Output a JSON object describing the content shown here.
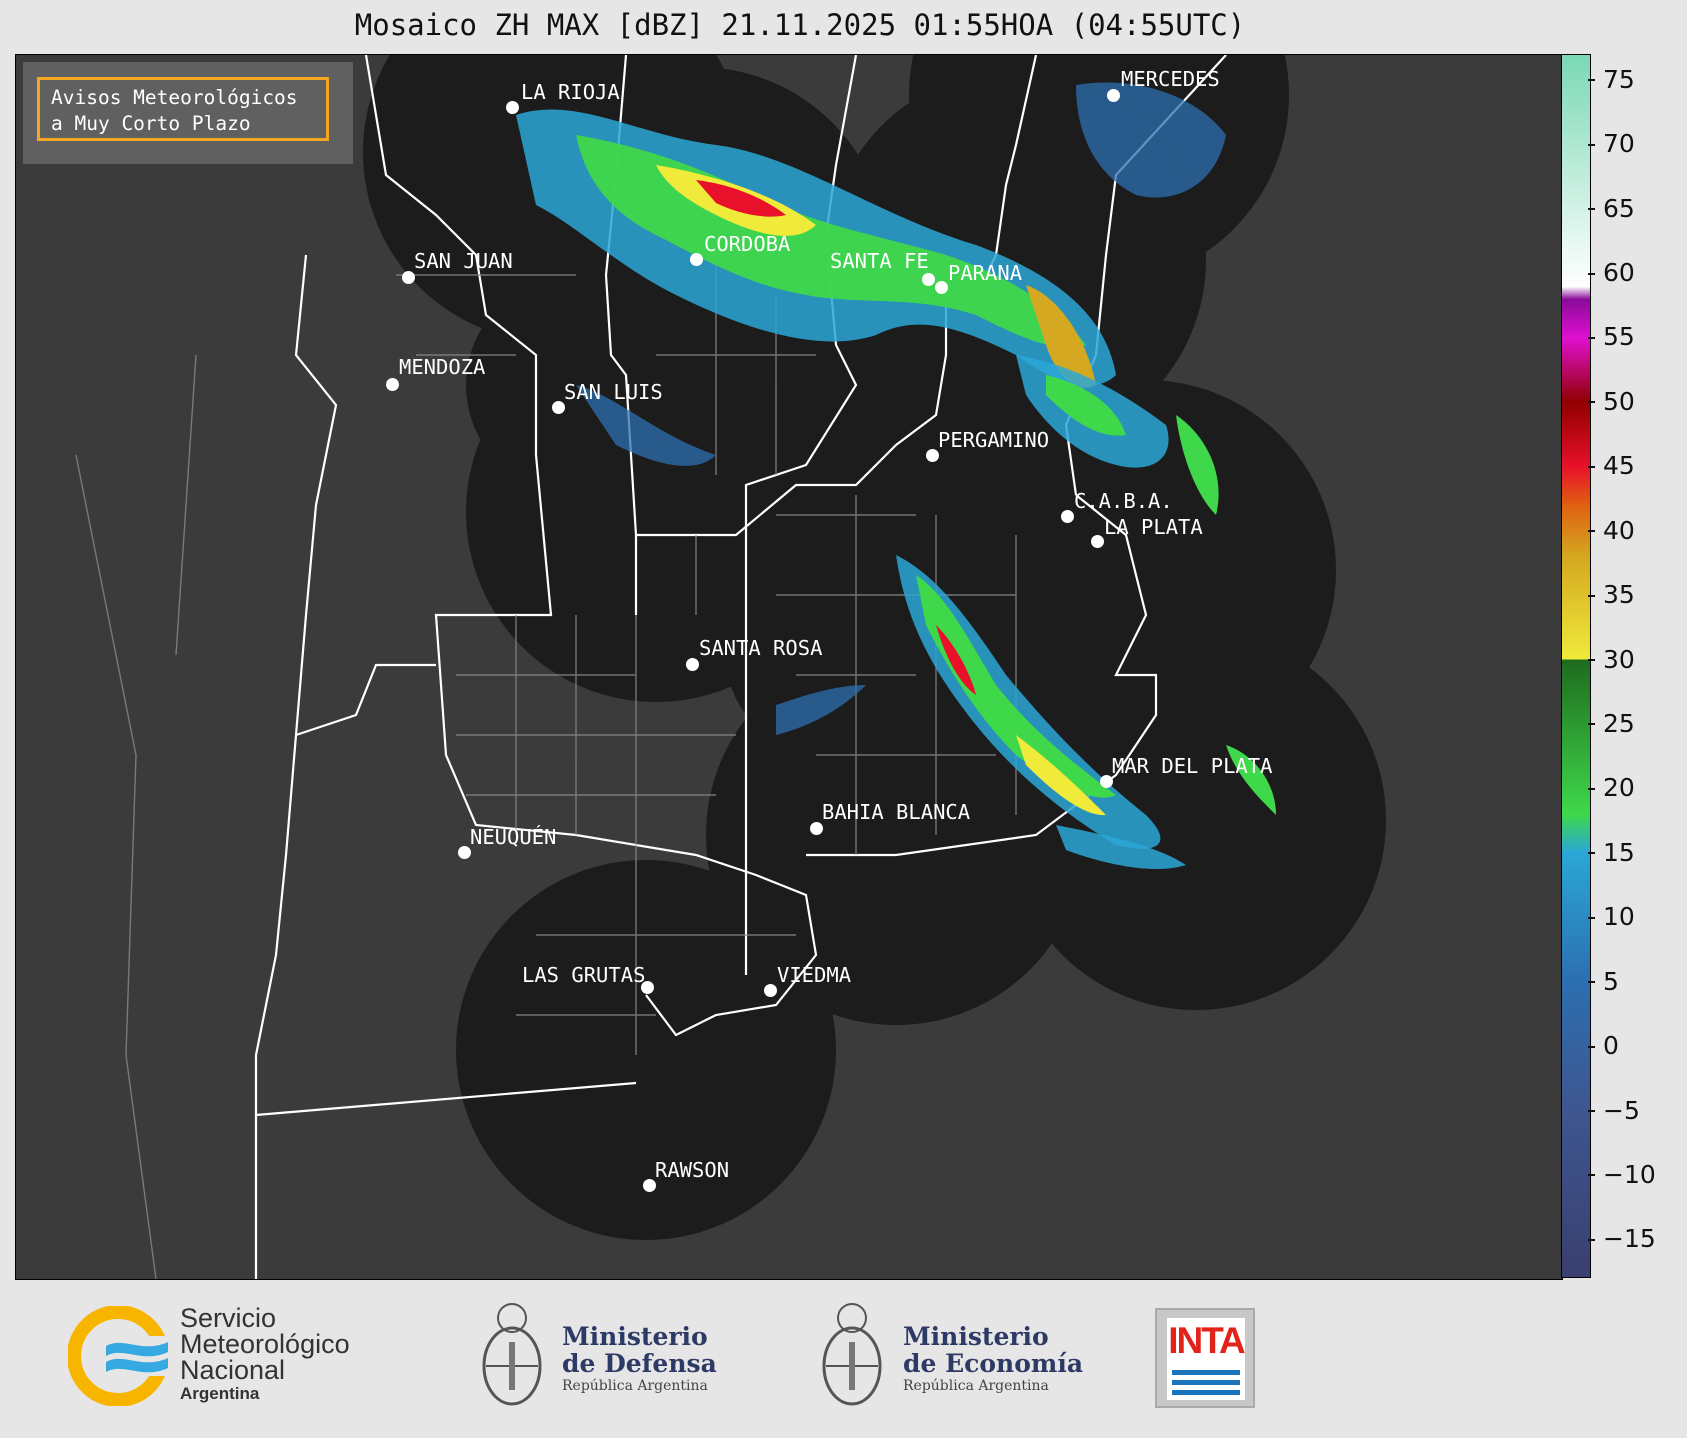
{
  "title": "Mosaico ZH MAX [dBZ] 21.11.2025 01:55HOA (04:55UTC)",
  "notice": {
    "line1": "Avisos Meteorológicos",
    "line2": "a Muy Corto Plazo"
  },
  "cities": [
    {
      "name": "LA RIOJA"
    },
    {
      "name": "MERCEDES"
    },
    {
      "name": "CORDOBA"
    },
    {
      "name": "SAN JUAN"
    },
    {
      "name": "SANTA FE"
    },
    {
      "name": "PARANA"
    },
    {
      "name": "MENDOZA"
    },
    {
      "name": "SAN LUIS"
    },
    {
      "name": "PERGAMINO"
    },
    {
      "name": "C.A.B.A."
    },
    {
      "name": "LA PLATA"
    },
    {
      "name": "SANTA ROSA"
    },
    {
      "name": "MAR DEL PLATA"
    },
    {
      "name": "BAHIA BLANCA"
    },
    {
      "name": "NEUQUÉN"
    },
    {
      "name": "LAS GRUTAS"
    },
    {
      "name": "VIEDMA"
    },
    {
      "name": "RAWSON"
    }
  ],
  "colorbar": {
    "unit": "dBZ",
    "range": [
      -18,
      77
    ],
    "ticks": [
      "75",
      "70",
      "65",
      "60",
      "55",
      "50",
      "45",
      "40",
      "35",
      "30",
      "25",
      "20",
      "15",
      "10",
      "5",
      "0",
      "−5",
      "−10",
      "−15"
    ],
    "stops": [
      {
        "v": -18,
        "color": "#3a3f6e"
      },
      {
        "v": -5,
        "color": "#3e5690"
      },
      {
        "v": 5,
        "color": "#2c6fb0"
      },
      {
        "v": 15,
        "color": "#2aa7d6"
      },
      {
        "v": 18,
        "color": "#3fd84a"
      },
      {
        "v": 30,
        "color": "#1e6b1e"
      },
      {
        "v": 30,
        "color": "#f0ea3a"
      },
      {
        "v": 38,
        "color": "#d4a820"
      },
      {
        "v": 42,
        "color": "#e06010"
      },
      {
        "v": 45,
        "color": "#e8102a"
      },
      {
        "v": 50,
        "color": "#900000"
      },
      {
        "v": 55,
        "color": "#e010d0"
      },
      {
        "v": 58,
        "color": "#8a0a9a"
      },
      {
        "v": 59,
        "color": "#ffffff"
      },
      {
        "v": 77,
        "color": "#7ad8b4"
      }
    ]
  },
  "logos": {
    "smn": {
      "line1": "Servicio",
      "line2": "Meteorológico",
      "line3": "Nacional",
      "line4": "Argentina"
    },
    "defensa": {
      "line1": "Ministerio",
      "line2": "de Defensa",
      "line3": "República Argentina"
    },
    "economia": {
      "line1": "Ministerio",
      "line2": "de Economía",
      "line3": "República Argentina"
    },
    "inta": {
      "word": "INTA"
    }
  }
}
